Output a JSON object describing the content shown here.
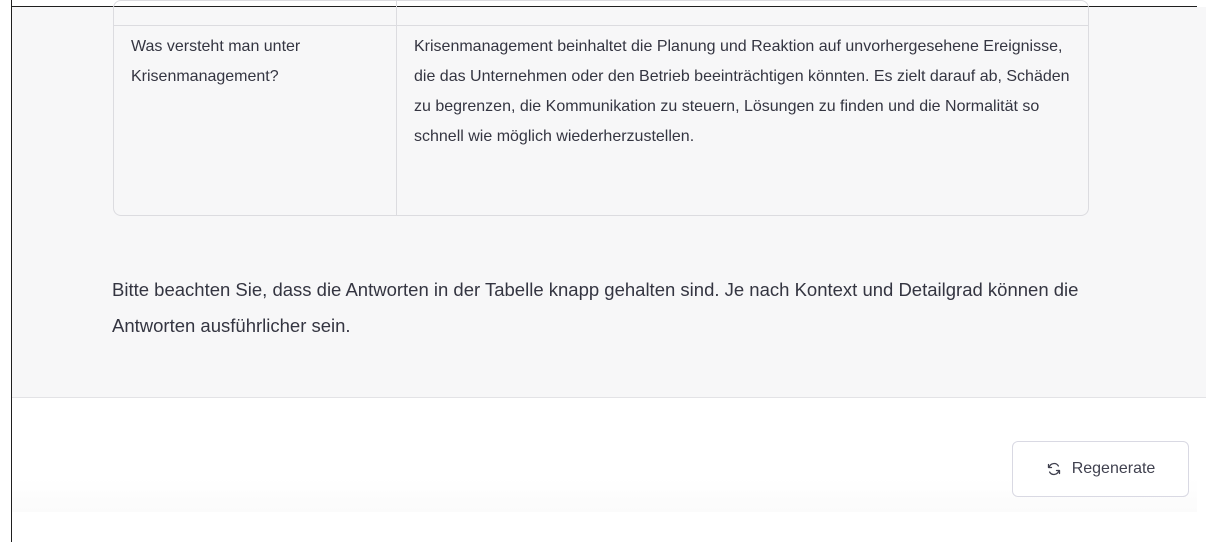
{
  "qa_table": {
    "rows": [
      {
        "question": "Was versteht man unter Krisenmanagement?",
        "answer": "Krisenmanagement beinhaltet die Planung und Reaktion auf unvorhergesehene Ereignisse, die das Unternehmen oder den Betrieb beeinträchtigen könnten. Es zielt darauf ab, Schäden zu begrenzen, die Kommunikation zu steuern, Lösungen zu finden und die Normalität so schnell wie möglich wiederherzustellen."
      }
    ]
  },
  "message": {
    "note": "Bitte beachten Sie, dass die Antworten in der Tabelle knapp gehalten sind. Je nach Kontext und Detailgrad können die Antworten ausführlicher sein."
  },
  "actions": {
    "regenerate_label": "Regenerate",
    "regenerate_icon": "refresh-icon"
  },
  "colors": {
    "message_background": "#f7f7f8",
    "text": "#343541",
    "border": "#dcdce0"
  }
}
